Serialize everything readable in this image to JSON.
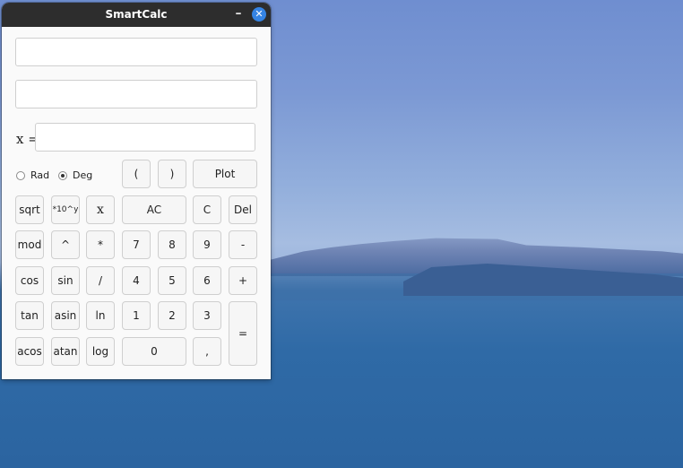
{
  "window": {
    "title": "SmartCalc",
    "minimize_glyph": "–",
    "close_glyph": "✕"
  },
  "inputs": {
    "expression": "",
    "result": "",
    "x_label": "x =",
    "x_value": ""
  },
  "mode": {
    "rad_label": "Rad",
    "deg_label": "Deg",
    "selected": "Deg"
  },
  "buttons": {
    "open_paren": "(",
    "close_paren": ")",
    "plot": "Plot",
    "sqrt": "sqrt",
    "pow10": "*10^y",
    "x": "x",
    "ac": "AC",
    "c": "C",
    "del": "Del",
    "mod": "mod",
    "caret": "^",
    "mul": "*",
    "n7": "7",
    "n8": "8",
    "n9": "9",
    "minus": "-",
    "cos": "cos",
    "sin": "sin",
    "div": "/",
    "n4": "4",
    "n5": "5",
    "n6": "6",
    "plus": "+",
    "tan": "tan",
    "asin": "asin",
    "ln": "ln",
    "n1": "1",
    "n2": "2",
    "n3": "3",
    "equals": "=",
    "acos": "acos",
    "atan": "atan",
    "log": "log",
    "n0": "0",
    "comma": ","
  }
}
